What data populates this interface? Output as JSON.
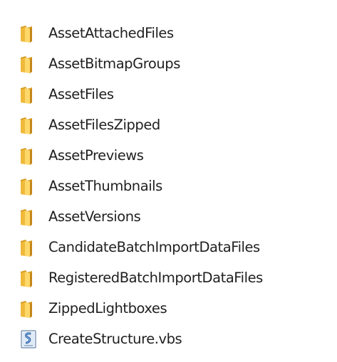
{
  "items": [
    {
      "label": "AssetAttachedFiles",
      "icon": "folder-icon"
    },
    {
      "label": "AssetBitmapGroups",
      "icon": "folder-icon"
    },
    {
      "label": "AssetFiles",
      "icon": "folder-icon"
    },
    {
      "label": "AssetFilesZipped",
      "icon": "folder-icon"
    },
    {
      "label": "AssetPreviews",
      "icon": "folder-icon"
    },
    {
      "label": "AssetThumbnails",
      "icon": "folder-icon"
    },
    {
      "label": "AssetVersions",
      "icon": "folder-icon"
    },
    {
      "label": "CandidateBatchImportDataFiles",
      "icon": "folder-icon"
    },
    {
      "label": "RegisteredBatchImportDataFiles",
      "icon": "folder-icon"
    },
    {
      "label": "ZippedLightboxes",
      "icon": "folder-icon"
    },
    {
      "label": "CreateStructure.vbs",
      "icon": "vbs-script-icon"
    }
  ],
  "colors": {
    "folder_light": "#ffd86a",
    "folder_dark": "#d59a20",
    "text": "#1f1f1f",
    "script_blue": "#3973b8"
  }
}
